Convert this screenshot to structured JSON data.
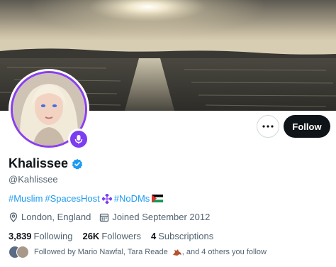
{
  "profile": {
    "display_name": "Khalissee",
    "handle": "@Kahlissee",
    "verified": true,
    "accent_color": "#1d9bf0",
    "avatar_ring_color": "#8a3ff0"
  },
  "actions": {
    "more_icon": "ellipsis-icon",
    "follow_label": "Follow"
  },
  "bio": {
    "hashtag_1": "#Muslim",
    "hashtag_2": "#SpacesHost",
    "hashtag_3": "#NoDMs"
  },
  "meta": {
    "location": "London, England",
    "joined": "Joined September 2012"
  },
  "stats": {
    "following_count": "3,839",
    "following_label": "Following",
    "followers_count": "26K",
    "followers_label": "Followers",
    "subscriptions_count": "4",
    "subscriptions_label": "Subscriptions"
  },
  "followed_by": {
    "prefix": "Followed by Mario Nawfal, Tara Reade",
    "suffix": ", and 4 others you follow"
  }
}
